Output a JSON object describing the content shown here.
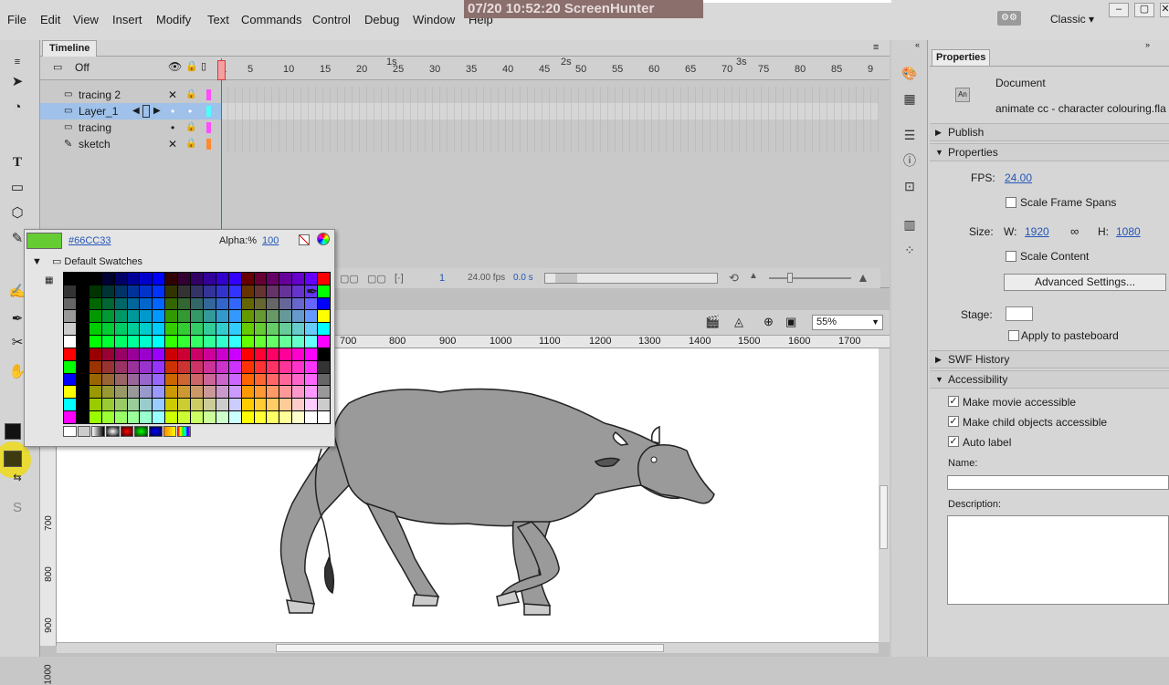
{
  "menu": [
    "File",
    "Edit",
    "View",
    "Insert",
    "Modify",
    "Text",
    "Commands",
    "Control",
    "Debug",
    "Window",
    "Help"
  ],
  "watermark": "07/20  10:52:20  ScreenHunter",
  "workspace": {
    "label": "Classic"
  },
  "window_buttons": [
    "–",
    "▢",
    "✕"
  ],
  "timeline": {
    "tab": "Timeline",
    "header_label": "Off",
    "seconds": [
      "1s",
      "2s",
      "3s"
    ],
    "frame_ticks": [
      "1",
      "5",
      "10",
      "15",
      "20",
      "25",
      "30",
      "35",
      "40",
      "45",
      "50",
      "55",
      "60",
      "65",
      "70",
      "75",
      "80",
      "85",
      "9"
    ],
    "layers": [
      {
        "name": "tracing 2",
        "selected": false
      },
      {
        "name": "Layer_1",
        "selected": true
      },
      {
        "name": "tracing",
        "selected": false
      },
      {
        "name": "sketch",
        "selected": false
      }
    ],
    "footer": {
      "frame": "1",
      "fps": "24.00 fps",
      "time": "0.0 s"
    }
  },
  "stage": {
    "zoom": "55%",
    "ruler_h": [
      "700",
      "800",
      "900",
      "1000",
      "1100",
      "1200",
      "1300",
      "1400",
      "1500",
      "1600",
      "1700"
    ],
    "ruler_v": [
      "700",
      "800",
      "900",
      "1000"
    ]
  },
  "swatches": {
    "hex": "#66CC33",
    "alpha_label": "Alpha:%",
    "alpha_value": "100",
    "folder": "Default Swatches"
  },
  "properties": {
    "tab": "Properties",
    "doc_type": "Document",
    "filename": "animate cc - character colouring.fla",
    "sections": {
      "publish": "Publish",
      "properties": "Properties",
      "swf_history": "SWF History",
      "accessibility": "Accessibility"
    },
    "fps_label": "FPS:",
    "fps_value": "24.00",
    "scale_frame_spans": "Scale Frame Spans",
    "size_label": "Size:",
    "w_label": "W:",
    "w_value": "1920",
    "h_label": "H:",
    "h_value": "1080",
    "scale_content": "Scale Content",
    "advanced_settings": "Advanced Settings...",
    "stage_label": "Stage:",
    "apply_to_pasteboard": "Apply to pasteboard",
    "make_movie_accessible": "Make movie accessible",
    "make_child_accessible": "Make child objects accessible",
    "auto_label": "Auto label",
    "name_label": "Name:",
    "description_label": "Description:"
  },
  "colors": {
    "accent_link": "#2456b8",
    "selected_fill": "#66cc33",
    "layer_selected": "#9fc1ea",
    "playhead": "#d43b3b"
  }
}
